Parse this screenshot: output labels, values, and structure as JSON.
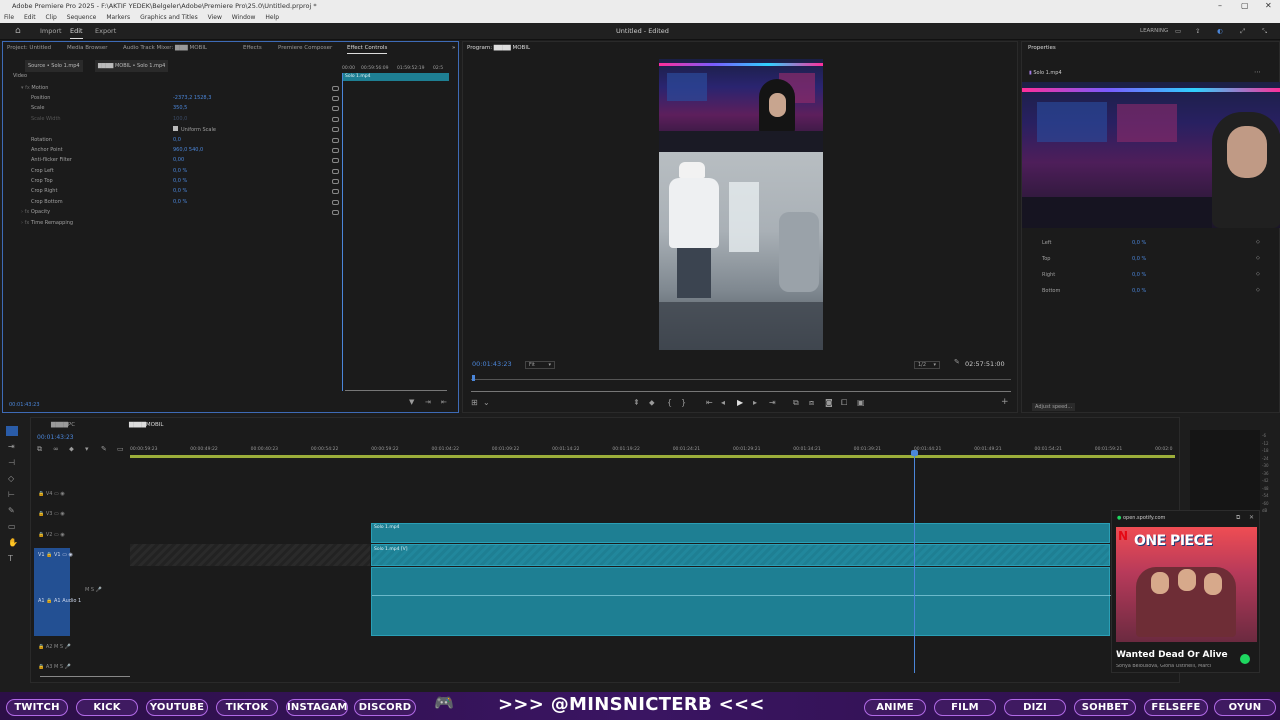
{
  "window": {
    "title": "Adobe Premiere Pro 2025 - F:\\AKTIF YEDEK\\Belgeler\\Adobe\\Premiere Pro\\25.0\\Untitled.prproj *"
  },
  "menu": [
    "File",
    "Edit",
    "Clip",
    "Sequence",
    "Markers",
    "Graphics and Titles",
    "View",
    "Window",
    "Help"
  ],
  "workspace": {
    "import": "Import",
    "edit": "Edit",
    "export": "Export",
    "title": "Untitled - Edited",
    "learning": "LEARNING"
  },
  "source_panel": {
    "tabs": [
      "Project: Untitled",
      "Media Browser",
      "Audio Track Mixer: ▇▇▇ MOBIL",
      "Effects",
      "Premiere Composer",
      "Effect Controls"
    ],
    "source_label": "Source • Solo 1.mp4",
    "seq_label": "▇▇▇▇ MOBIL • Solo 1.mp4",
    "mini_times": [
      "00:00",
      "00:59:56:09",
      "01:59:52:19",
      "02:5"
    ],
    "mini_clip": "Solo 1.mp4",
    "video_label": "Video",
    "timecode": "00:01:43:23",
    "props": [
      {
        "name": "Motion",
        "value": ""
      },
      {
        "name": "Position",
        "value": "-2373,2   1528,3"
      },
      {
        "name": "Scale",
        "value": "350,5"
      },
      {
        "name": "Scale Width",
        "value": "100,0"
      },
      {
        "name": "Uniform Scale",
        "value": ""
      },
      {
        "name": "Rotation",
        "value": "0,0"
      },
      {
        "name": "Anchor Point",
        "value": "960,0    540,0"
      },
      {
        "name": "Anti-flicker Filter",
        "value": "0,00"
      },
      {
        "name": "Crop Left",
        "value": "0,0 %"
      },
      {
        "name": "Crop Top",
        "value": "0,0 %"
      },
      {
        "name": "Crop Right",
        "value": "0,0 %"
      },
      {
        "name": "Crop Bottom",
        "value": "0,0 %"
      },
      {
        "name": "Opacity",
        "value": ""
      },
      {
        "name": "Time Remapping",
        "value": ""
      }
    ]
  },
  "program": {
    "tab": "Program: ▇▇▇▇ MOBIL",
    "timecode": "00:01:43:23",
    "fit": "Fit",
    "res": "1/2",
    "duration": "02:57:51:00"
  },
  "properties": {
    "tab": "Properties",
    "clip": "Solo 1.mp4",
    "rows": [
      {
        "name": "Left",
        "value": "0,0 %"
      },
      {
        "name": "Top",
        "value": "0,0 %"
      },
      {
        "name": "Right",
        "value": "0,0 %"
      },
      {
        "name": "Bottom",
        "value": "0,0 %"
      }
    ],
    "adjust": "Adjust speed..."
  },
  "timeline": {
    "tabs": [
      "▇▇▇▇PC",
      "▇▇▇▇MOBIL"
    ],
    "timecode": "00:01:43:23",
    "ruler": [
      "00:00:59:23",
      "00:00:49:22",
      "00:00:40:23",
      "00:00:54:22",
      "00:00:59:22",
      "00:01:04:22",
      "00:01:09:22",
      "00:01:14:22",
      "00:01:19:22",
      "00:01:24:21",
      "00:01:29:21",
      "00:01:34:21",
      "00:01:39:21",
      "00:01:44:21",
      "00:01:49:21",
      "00:01:54:21",
      "00:01:59:21",
      "00:02:0"
    ],
    "tracks": [
      "V4",
      "V3",
      "V2",
      "V1",
      "A1",
      "A2",
      "A3"
    ],
    "audio_label": "Audio 1",
    "clip_v2": "Solo 1.mp4",
    "clip_v1": "Solo 1.mp4 [V]"
  },
  "spotify": {
    "host": "open.spotify.com",
    "cover": "ONE PIECE",
    "song": "Wanted Dead Or Alive",
    "artists": "Sonya Belousova, Giona Ostinelli, Marci"
  },
  "banner": {
    "left": [
      "TWITCH",
      "KICK",
      "YOUTUBE",
      "TIKTOK",
      "INSTAGAM",
      "DISCORD"
    ],
    "handle": ">>> @MINSNICTERB <<<",
    "right": [
      "ANIME",
      "FILM",
      "DIZI",
      "SOHBET",
      "FELSEFE",
      "OYUN"
    ]
  }
}
